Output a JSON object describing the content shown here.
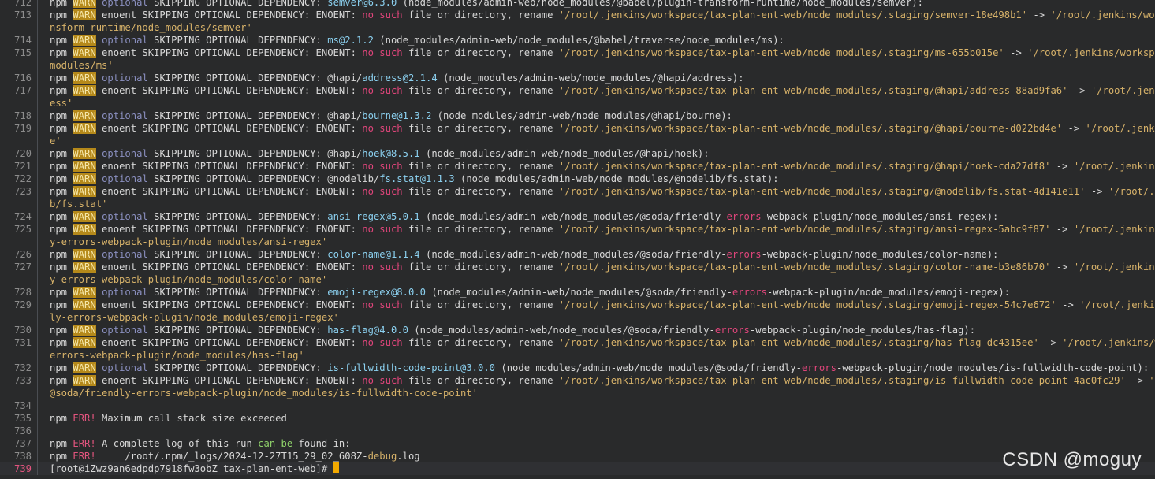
{
  "terminal": {
    "prompt": "[root@iZwz9an6edpdp7918fw3obZ tax-plan-ent-web]#",
    "cursor_color": "#f2a900",
    "warn_color": "#b5891a",
    "err_color": "#e2547e"
  },
  "lines": [
    {
      "num": "712",
      "segs": [
        [
          "npm ",
          ""
        ],
        [
          "WARN",
          "warn"
        ],
        [
          " ",
          ""
        ],
        [
          "optional",
          "opt"
        ],
        [
          " SKIPPING OPTIONAL DEPENDENCY: ",
          ""
        ],
        [
          "semver@6.3.0",
          "ver"
        ],
        [
          " (node_modules/admin-web/node_modules/@babel/plugin-transform-runtime/node_modules/semver):",
          ""
        ]
      ]
    },
    {
      "num": "713",
      "segs": [
        [
          "npm ",
          ""
        ],
        [
          "WARN",
          "warn"
        ],
        [
          " enoent SKIPPING OPTIONAL DEPENDENCY: ENOENT: ",
          ""
        ],
        [
          "no",
          "key"
        ],
        [
          " ",
          ""
        ],
        [
          "such",
          "key"
        ],
        [
          " file or directory, rename ",
          ""
        ],
        [
          "'/root/.jenkins/workspace/tax-plan-ent-web/node_modules/.staging/semver-18e498b1'",
          "path"
        ],
        [
          " -> ",
          ""
        ],
        [
          "'/root/.jenkins/workspace/t",
          "path"
        ]
      ]
    },
    {
      "num": "",
      "segs": [
        [
          "nsform-runtime/node_modules/semver'",
          "path"
        ]
      ]
    },
    {
      "num": "714",
      "segs": [
        [
          "npm ",
          ""
        ],
        [
          "WARN",
          "warn"
        ],
        [
          " ",
          ""
        ],
        [
          "optional",
          "opt"
        ],
        [
          " SKIPPING OPTIONAL DEPENDENCY: ",
          ""
        ],
        [
          "ms@2.1.2",
          "ver"
        ],
        [
          " (node_modules/admin-web/node_modules/@babel/traverse/node_modules/ms):",
          ""
        ]
      ]
    },
    {
      "num": "715",
      "segs": [
        [
          "npm ",
          ""
        ],
        [
          "WARN",
          "warn"
        ],
        [
          " enoent SKIPPING OPTIONAL DEPENDENCY: ENOENT: ",
          ""
        ],
        [
          "no",
          "key"
        ],
        [
          " ",
          ""
        ],
        [
          "such",
          "key"
        ],
        [
          " file or directory, rename ",
          ""
        ],
        [
          "'/root/.jenkins/workspace/tax-plan-ent-web/node_modules/.staging/ms-655b015e'",
          "path"
        ],
        [
          " -> ",
          ""
        ],
        [
          "'/root/.jenkins/workspace/tax-p",
          "path"
        ]
      ]
    },
    {
      "num": "",
      "segs": [
        [
          "modules/ms'",
          "path"
        ]
      ]
    },
    {
      "num": "716",
      "segs": [
        [
          "npm ",
          ""
        ],
        [
          "WARN",
          "warn"
        ],
        [
          " ",
          ""
        ],
        [
          "optional",
          "opt"
        ],
        [
          " SKIPPING OPTIONAL DEPENDENCY: @hapi/",
          ""
        ],
        [
          "address@2.1.4",
          "ver"
        ],
        [
          " (node_modules/admin-web/node_modules/@hapi/address):",
          ""
        ]
      ]
    },
    {
      "num": "717",
      "segs": [
        [
          "npm ",
          ""
        ],
        [
          "WARN",
          "warn"
        ],
        [
          " enoent SKIPPING OPTIONAL DEPENDENCY: ENOENT: ",
          ""
        ],
        [
          "no",
          "key"
        ],
        [
          " ",
          ""
        ],
        [
          "such",
          "key"
        ],
        [
          " file or directory, rename ",
          ""
        ],
        [
          "'/root/.jenkins/workspace/tax-plan-ent-web/node_modules/.staging/@hapi/address-88ad9fa6'",
          "path"
        ],
        [
          " -> ",
          ""
        ],
        [
          "'/root/.jenkins/work",
          "path"
        ]
      ]
    },
    {
      "num": "",
      "segs": [
        [
          "ess'",
          "path"
        ]
      ]
    },
    {
      "num": "718",
      "segs": [
        [
          "npm ",
          ""
        ],
        [
          "WARN",
          "warn"
        ],
        [
          " ",
          ""
        ],
        [
          "optional",
          "opt"
        ],
        [
          " SKIPPING OPTIONAL DEPENDENCY: @hapi/",
          ""
        ],
        [
          "bourne@1.3.2",
          "ver"
        ],
        [
          " (node_modules/admin-web/node_modules/@hapi/bourne):",
          ""
        ]
      ]
    },
    {
      "num": "719",
      "segs": [
        [
          "npm ",
          ""
        ],
        [
          "WARN",
          "warn"
        ],
        [
          " enoent SKIPPING OPTIONAL DEPENDENCY: ENOENT: ",
          ""
        ],
        [
          "no",
          "key"
        ],
        [
          " ",
          ""
        ],
        [
          "such",
          "key"
        ],
        [
          " file or directory, rename ",
          ""
        ],
        [
          "'/root/.jenkins/workspace/tax-plan-ent-web/node_modules/.staging/@hapi/bourne-d022bd4e'",
          "path"
        ],
        [
          " -> ",
          ""
        ],
        [
          "'/root/.jenkins/works",
          "path"
        ]
      ]
    },
    {
      "num": "",
      "segs": [
        [
          "e'",
          "path"
        ]
      ]
    },
    {
      "num": "720",
      "segs": [
        [
          "npm ",
          ""
        ],
        [
          "WARN",
          "warn"
        ],
        [
          " ",
          ""
        ],
        [
          "optional",
          "opt"
        ],
        [
          " SKIPPING OPTIONAL DEPENDENCY: @hapi/",
          ""
        ],
        [
          "hoek@8.5.1",
          "ver"
        ],
        [
          " (node_modules/admin-web/node_modules/@hapi/hoek):",
          ""
        ]
      ]
    },
    {
      "num": "721",
      "segs": [
        [
          "npm ",
          ""
        ],
        [
          "WARN",
          "warn"
        ],
        [
          " enoent SKIPPING OPTIONAL DEPENDENCY: ENOENT: ",
          ""
        ],
        [
          "no",
          "key"
        ],
        [
          " ",
          ""
        ],
        [
          "such",
          "key"
        ],
        [
          " file or directory, rename ",
          ""
        ],
        [
          "'/root/.jenkins/workspace/tax-plan-ent-web/node_modules/.staging/@hapi/hoek-cda27df8'",
          "path"
        ],
        [
          " -> ",
          ""
        ],
        [
          "'/root/.jenkins/workspa",
          "path"
        ]
      ]
    },
    {
      "num": "722",
      "segs": [
        [
          "npm ",
          ""
        ],
        [
          "WARN",
          "warn"
        ],
        [
          " ",
          ""
        ],
        [
          "optional",
          "opt"
        ],
        [
          " SKIPPING OPTIONAL DEPENDENCY: @nodelib/",
          ""
        ],
        [
          "fs.stat@1.1.3",
          "ver"
        ],
        [
          " (node_modules/admin-web/node_modules/@nodelib/fs.stat):",
          ""
        ]
      ]
    },
    {
      "num": "723",
      "segs": [
        [
          "npm ",
          ""
        ],
        [
          "WARN",
          "warn"
        ],
        [
          " enoent SKIPPING OPTIONAL DEPENDENCY: ENOENT: ",
          ""
        ],
        [
          "no",
          "key"
        ],
        [
          " ",
          ""
        ],
        [
          "such",
          "key"
        ],
        [
          " file or directory, rename ",
          ""
        ],
        [
          "'/root/.jenkins/workspace/tax-plan-ent-web/node_modules/.staging/@nodelib/fs.stat-4d141e11'",
          "path"
        ],
        [
          " -> ",
          ""
        ],
        [
          "'/root/.jenkins/w",
          "path"
        ]
      ]
    },
    {
      "num": "",
      "segs": [
        [
          "b/fs.stat'",
          "path"
        ]
      ]
    },
    {
      "num": "724",
      "segs": [
        [
          "npm ",
          ""
        ],
        [
          "WARN",
          "warn"
        ],
        [
          " ",
          ""
        ],
        [
          "optional",
          "opt"
        ],
        [
          " SKIPPING OPTIONAL DEPENDENCY: ",
          ""
        ],
        [
          "ansi-regex@5.0.1",
          "ver"
        ],
        [
          " (node_modules/admin-web/node_modules/@soda/friendly-",
          ""
        ],
        [
          "errors",
          "key"
        ],
        [
          "-webpack-plugin/node_modules/ansi-regex):",
          ""
        ]
      ]
    },
    {
      "num": "725",
      "segs": [
        [
          "npm ",
          ""
        ],
        [
          "WARN",
          "warn"
        ],
        [
          " enoent SKIPPING OPTIONAL DEPENDENCY: ENOENT: ",
          ""
        ],
        [
          "no",
          "key"
        ],
        [
          " ",
          ""
        ],
        [
          "such",
          "key"
        ],
        [
          " file or directory, rename ",
          ""
        ],
        [
          "'/root/.jenkins/workspace/tax-plan-ent-web/node_modules/.staging/ansi-regex-5abc9f87'",
          "path"
        ],
        [
          " -> ",
          ""
        ],
        [
          "'/root/.jenkins/workspace/t",
          "path"
        ]
      ]
    },
    {
      "num": "",
      "segs": [
        [
          "y-errors-webpack-plugin/node_modules/ansi-regex'",
          "path"
        ]
      ]
    },
    {
      "num": "726",
      "segs": [
        [
          "npm ",
          ""
        ],
        [
          "WARN",
          "warn"
        ],
        [
          " ",
          ""
        ],
        [
          "optional",
          "opt"
        ],
        [
          " SKIPPING OPTIONAL DEPENDENCY: ",
          ""
        ],
        [
          "color-name@1.1.4",
          "ver"
        ],
        [
          " (node_modules/admin-web/node_modules/@soda/friendly-",
          ""
        ],
        [
          "errors",
          "key"
        ],
        [
          "-webpack-plugin/node_modules/color-name):",
          ""
        ]
      ]
    },
    {
      "num": "727",
      "segs": [
        [
          "npm ",
          ""
        ],
        [
          "WARN",
          "warn"
        ],
        [
          " enoent SKIPPING OPTIONAL DEPENDENCY: ENOENT: ",
          ""
        ],
        [
          "no",
          "key"
        ],
        [
          " ",
          ""
        ],
        [
          "such",
          "key"
        ],
        [
          " file or directory, rename ",
          ""
        ],
        [
          "'/root/.jenkins/workspace/tax-plan-ent-web/node_modules/.staging/color-name-b3e86b70'",
          "path"
        ],
        [
          " -> ",
          ""
        ],
        [
          "'/root/.jenkins/workspace/t",
          "path"
        ]
      ]
    },
    {
      "num": "",
      "segs": [
        [
          "y-errors-webpack-plugin/node_modules/color-name'",
          "path"
        ]
      ]
    },
    {
      "num": "728",
      "segs": [
        [
          "npm ",
          ""
        ],
        [
          "WARN",
          "warn"
        ],
        [
          " ",
          ""
        ],
        [
          "optional",
          "opt"
        ],
        [
          " SKIPPING OPTIONAL DEPENDENCY: ",
          ""
        ],
        [
          "emoji-regex@8.0.0",
          "ver"
        ],
        [
          " (node_modules/admin-web/node_modules/@soda/friendly-",
          ""
        ],
        [
          "errors",
          "key"
        ],
        [
          "-webpack-plugin/node_modules/emoji-regex):",
          ""
        ]
      ]
    },
    {
      "num": "729",
      "segs": [
        [
          "npm ",
          ""
        ],
        [
          "WARN",
          "warn"
        ],
        [
          " enoent SKIPPING OPTIONAL DEPENDENCY: ENOENT: ",
          ""
        ],
        [
          "no",
          "key"
        ],
        [
          " ",
          ""
        ],
        [
          "such",
          "key"
        ],
        [
          " file or directory, rename ",
          ""
        ],
        [
          "'/root/.jenkins/workspace/tax-plan-ent-web/node_modules/.staging/emoji-regex-54c7e672'",
          "path"
        ],
        [
          " -> ",
          ""
        ],
        [
          "'/root/.jenkins/worksp",
          "path"
        ]
      ]
    },
    {
      "num": "",
      "segs": [
        [
          "ly-errors-webpack-plugin/node_modules/emoji-regex'",
          "path"
        ]
      ]
    },
    {
      "num": "730",
      "segs": [
        [
          "npm ",
          ""
        ],
        [
          "WARN",
          "warn"
        ],
        [
          " ",
          ""
        ],
        [
          "optional",
          "opt"
        ],
        [
          " SKIPPING OPTIONAL DEPENDENCY: ",
          ""
        ],
        [
          "has-flag@4.0.0",
          "ver"
        ],
        [
          " (node_modules/admin-web/node_modules/@soda/friendly-",
          ""
        ],
        [
          "errors",
          "key"
        ],
        [
          "-webpack-plugin/node_modules/has-flag):",
          ""
        ]
      ]
    },
    {
      "num": "731",
      "segs": [
        [
          "npm ",
          ""
        ],
        [
          "WARN",
          "warn"
        ],
        [
          " enoent SKIPPING OPTIONAL DEPENDENCY: ENOENT: ",
          ""
        ],
        [
          "no",
          "key"
        ],
        [
          " ",
          ""
        ],
        [
          "such",
          "key"
        ],
        [
          " file or directory, rename ",
          ""
        ],
        [
          "'/root/.jenkins/workspace/tax-plan-ent-web/node_modules/.staging/has-flag-dc4315ee'",
          "path"
        ],
        [
          " -> ",
          ""
        ],
        [
          "'/root/.jenkins/workspace",
          "path"
        ]
      ]
    },
    {
      "num": "",
      "segs": [
        [
          "errors-webpack-plugin/node_modules/has-flag'",
          "path"
        ]
      ]
    },
    {
      "num": "732",
      "segs": [
        [
          "npm ",
          ""
        ],
        [
          "WARN",
          "warn"
        ],
        [
          " ",
          ""
        ],
        [
          "optional",
          "opt"
        ],
        [
          " SKIPPING OPTIONAL DEPENDENCY: ",
          ""
        ],
        [
          "is-fullwidth-code-point@3.0.0",
          "ver"
        ],
        [
          " (node_modules/admin-web/node_modules/@soda/friendly-",
          ""
        ],
        [
          "errors",
          "key"
        ],
        [
          "-webpack-plugin/node_modules/is-fullwidth-code-point):",
          ""
        ]
      ]
    },
    {
      "num": "733",
      "segs": [
        [
          "npm ",
          ""
        ],
        [
          "WARN",
          "warn"
        ],
        [
          " enoent SKIPPING OPTIONAL DEPENDENCY: ENOENT: ",
          ""
        ],
        [
          "no",
          "key"
        ],
        [
          " ",
          ""
        ],
        [
          "such",
          "key"
        ],
        [
          " file or directory, rename ",
          ""
        ],
        [
          "'/root/.jenkins/workspace/tax-plan-ent-web/node_modules/.staging/is-fullwidth-code-point-4ac0fc29'",
          "path"
        ],
        [
          " -> ",
          ""
        ],
        [
          "'/root/.je",
          "path"
        ]
      ]
    },
    {
      "num": "",
      "segs": [
        [
          "@soda/friendly-errors-webpack-plugin/node_modules/is-fullwidth-code-point'",
          "path"
        ]
      ]
    },
    {
      "num": "734",
      "segs": []
    },
    {
      "num": "735",
      "segs": [
        [
          "npm ",
          ""
        ],
        [
          "ERR!",
          "err"
        ],
        [
          " Maximum call stack size exceeded",
          ""
        ]
      ]
    },
    {
      "num": "736",
      "segs": []
    },
    {
      "num": "737",
      "segs": [
        [
          "npm ",
          ""
        ],
        [
          "ERR!",
          "err"
        ],
        [
          " A complete log of this run ",
          ""
        ],
        [
          "can",
          "green"
        ],
        [
          " ",
          ""
        ],
        [
          "be",
          "green"
        ],
        [
          " found in:",
          ""
        ]
      ]
    },
    {
      "num": "738",
      "segs": [
        [
          "npm ",
          ""
        ],
        [
          "ERR!",
          "err"
        ],
        [
          "     /root/.npm/_logs/2024-12-27T15_29_02_608Z-",
          ""
        ],
        [
          "debug",
          "path"
        ],
        [
          ".log",
          ""
        ]
      ]
    }
  ],
  "prompt_line": {
    "num": "739"
  },
  "watermark": "CSDN @moguy"
}
